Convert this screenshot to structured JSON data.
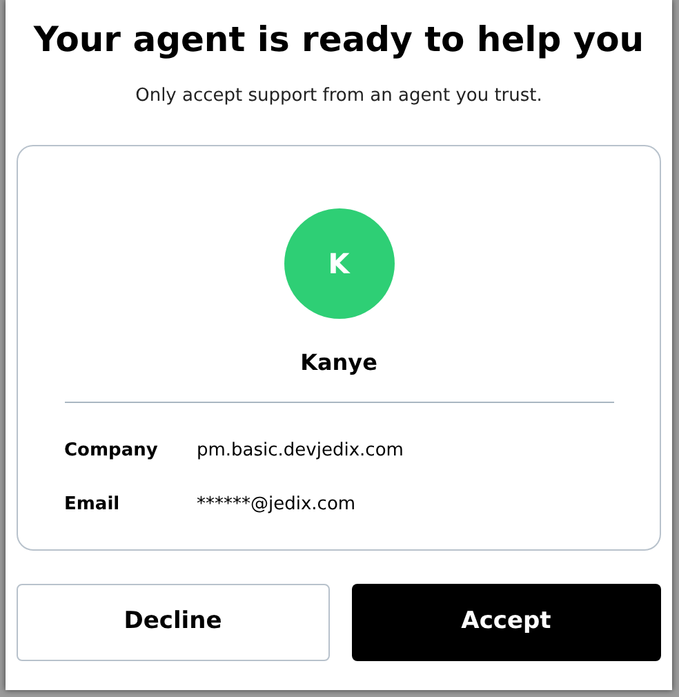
{
  "title": "Your agent is ready to help you",
  "subtitle": "Only accept support from an agent you trust.",
  "agent": {
    "initial": "K",
    "color": "#2ecf75",
    "name": "Kanye"
  },
  "details": [
    {
      "label": "Company",
      "value": "pm.basic.devjedix.com"
    },
    {
      "label": "Email",
      "value": "******@jedix.com"
    }
  ],
  "buttons": [
    {
      "label": "Decline",
      "kind": "secondary"
    },
    {
      "label": "Accept",
      "kind": "primary"
    }
  ]
}
